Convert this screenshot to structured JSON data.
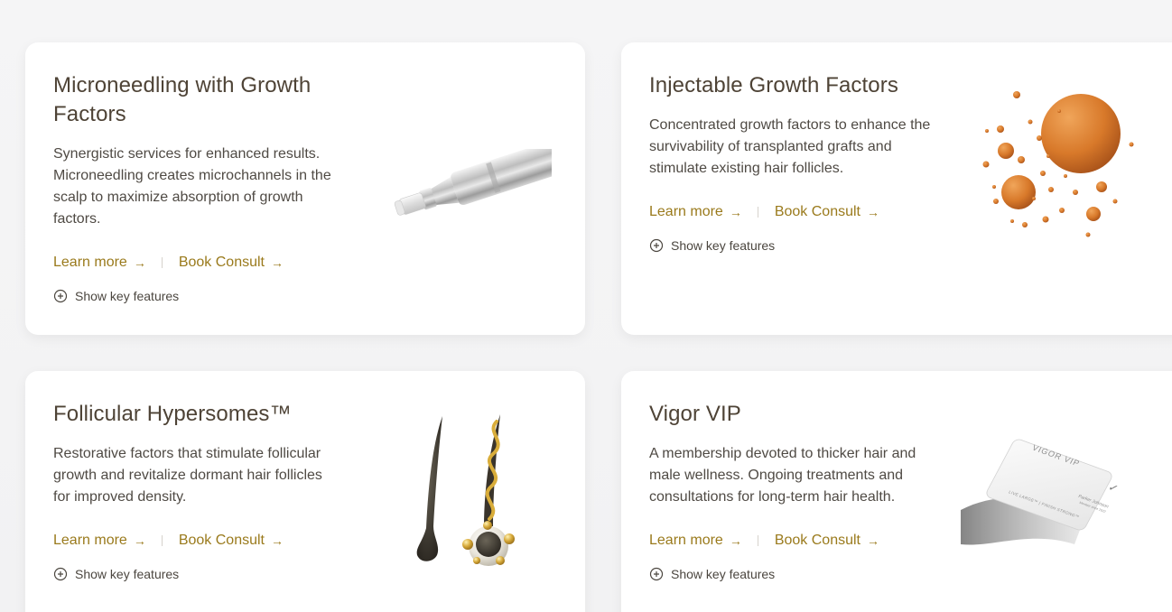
{
  "cards": [
    {
      "title": "Microneedling with Growth Factors",
      "description": "Synergistic services for enhanced results. Microneedling creates microchannels in the scalp to maximize absorption of growth factors.",
      "learn_more": "Learn more",
      "book_consult": "Book Consult",
      "show_features": "Show key features",
      "image_icon": "microneedling-pen-image"
    },
    {
      "title": "Injectable Growth Factors",
      "description": "Concentrated growth factors to enhance the survivability of transplanted grafts and stimulate existing hair follicles.",
      "learn_more": "Learn more",
      "book_consult": "Book Consult",
      "show_features": "Show key features",
      "image_icon": "growth-factor-spheres-image"
    },
    {
      "title": "Follicular Hypersomes™",
      "description": "Restorative factors that stimulate follicular growth and revitalize dormant hair follicles for improved density.",
      "learn_more": "Learn more",
      "book_consult": "Book Consult",
      "show_features": "Show key features",
      "image_icon": "hair-follicle-image"
    },
    {
      "title": "Vigor VIP",
      "description": "A membership devoted to thicker hair and male wellness. Ongoing treatments and consultations for long-term hair health.",
      "learn_more": "Learn more",
      "book_consult": "Book Consult",
      "show_features": "Show key features",
      "image_icon": "membership-card-image",
      "card_brand": "VIGOR VIP",
      "card_name": "Parker Johnson",
      "card_member": "Member since 2022",
      "card_tagline": "LIVE LARGE™ | FINISH STRONG™"
    }
  ],
  "colors": {
    "link": "#9a7a1c",
    "title": "#4e4336",
    "text": "#4f4a44",
    "background": "#f4f4f5",
    "card": "#ffffff"
  }
}
